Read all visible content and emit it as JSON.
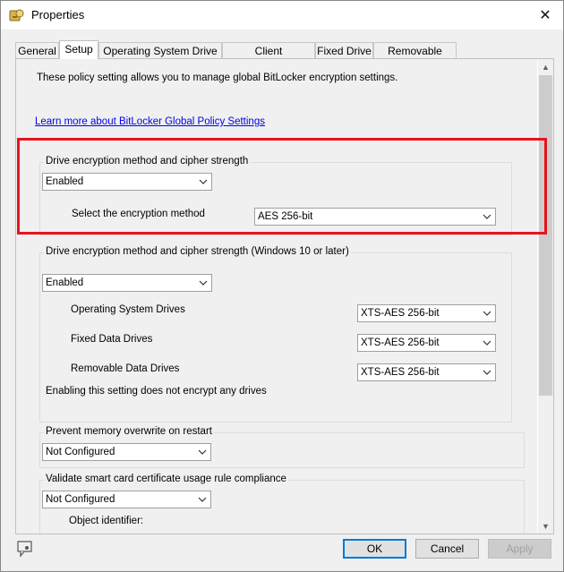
{
  "window": {
    "title": "Properties"
  },
  "tabs": [
    {
      "label": "General"
    },
    {
      "label": "Setup"
    },
    {
      "label": "Operating System Drive"
    },
    {
      "label": "Client Management"
    },
    {
      "label": "Fixed Drive"
    },
    {
      "label": "Removable Drive"
    }
  ],
  "active_tab": "Setup",
  "setup": {
    "description": "These policy setting allows you to manage global BitLocker encryption settings.",
    "learn_more_link": "Learn more about BitLocker Global Policy Settings",
    "group_cipher": {
      "title": "Drive encryption method and cipher strength",
      "state": "Enabled",
      "method_label": "Select the encryption method",
      "method_value": "AES 256-bit"
    },
    "group_cipher_win10": {
      "title": "Drive encryption method and cipher strength (Windows 10 or later)",
      "state": "Enabled",
      "os_label": "Operating System Drives",
      "os_value": "XTS-AES 256-bit",
      "fixed_label": "Fixed Data Drives",
      "fixed_value": "XTS-AES 256-bit",
      "removable_label": "Removable Data Drives",
      "removable_value": "XTS-AES 256-bit",
      "note": "Enabling this setting does not encrypt any drives"
    },
    "group_memory": {
      "title": "Prevent memory overwrite on restart",
      "state": "Not Configured"
    },
    "group_smartcard": {
      "title": "Validate smart card certificate usage rule compliance",
      "state": "Not Configured",
      "object_identifier_label": "Object identifier:"
    }
  },
  "buttons": {
    "ok": "OK",
    "cancel": "Cancel",
    "apply": "Apply"
  },
  "colors": {
    "highlight": "#e8131c",
    "link": "#0000ee",
    "focus": "#0078d7"
  }
}
